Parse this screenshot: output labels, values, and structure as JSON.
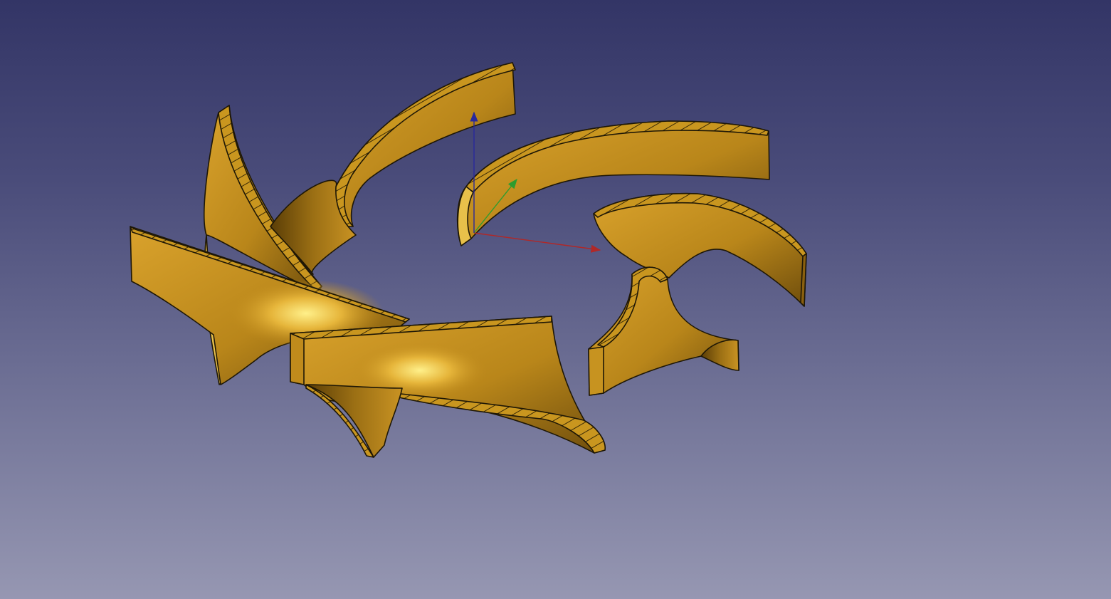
{
  "viewport": {
    "background_top": "#333566",
    "background_bottom": "#9697b2"
  },
  "model": {
    "part_color": "#c48f1e",
    "highlight_color": "#f7dc6a",
    "shadow_color": "#6a4a0a",
    "edge_color": "#1e1706",
    "blade_count": 7
  },
  "axes": {
    "x_color": "#b02828",
    "y_color": "#2e9c2e",
    "z_color": "#28289c"
  }
}
